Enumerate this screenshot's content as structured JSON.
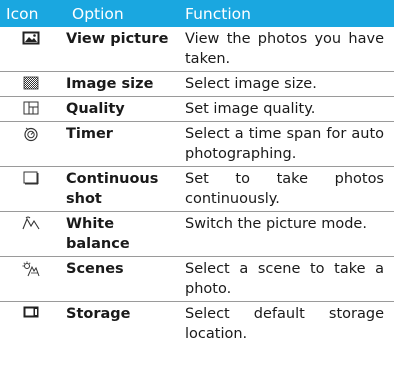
{
  "header": {
    "icon": "Icon",
    "option": "Option",
    "function": "Function"
  },
  "colors": {
    "header_bg": "#1aa7e0",
    "header_text": "#ffffff",
    "rule": "#9a9a9a"
  },
  "rows": [
    {
      "icon": "view-picture-icon",
      "option": "View picture",
      "function": "View the photos you have taken."
    },
    {
      "icon": "image-size-icon",
      "option": "Image size",
      "function": "Select image size."
    },
    {
      "icon": "quality-icon",
      "option": "Quality",
      "function": "Set image quality."
    },
    {
      "icon": "timer-icon",
      "option": "Timer",
      "function": "Select a time span for auto photographing."
    },
    {
      "icon": "continuous-shot-icon",
      "option": "Continuous shot",
      "function": "Set to take photos continuously."
    },
    {
      "icon": "white-balance-icon",
      "option": "White balance",
      "function": "Switch the picture mode."
    },
    {
      "icon": "scenes-icon",
      "option": "Scenes",
      "function": "Select a scene to take a photo."
    },
    {
      "icon": "storage-icon",
      "option": "Storage",
      "function": "Select default storage location."
    }
  ]
}
